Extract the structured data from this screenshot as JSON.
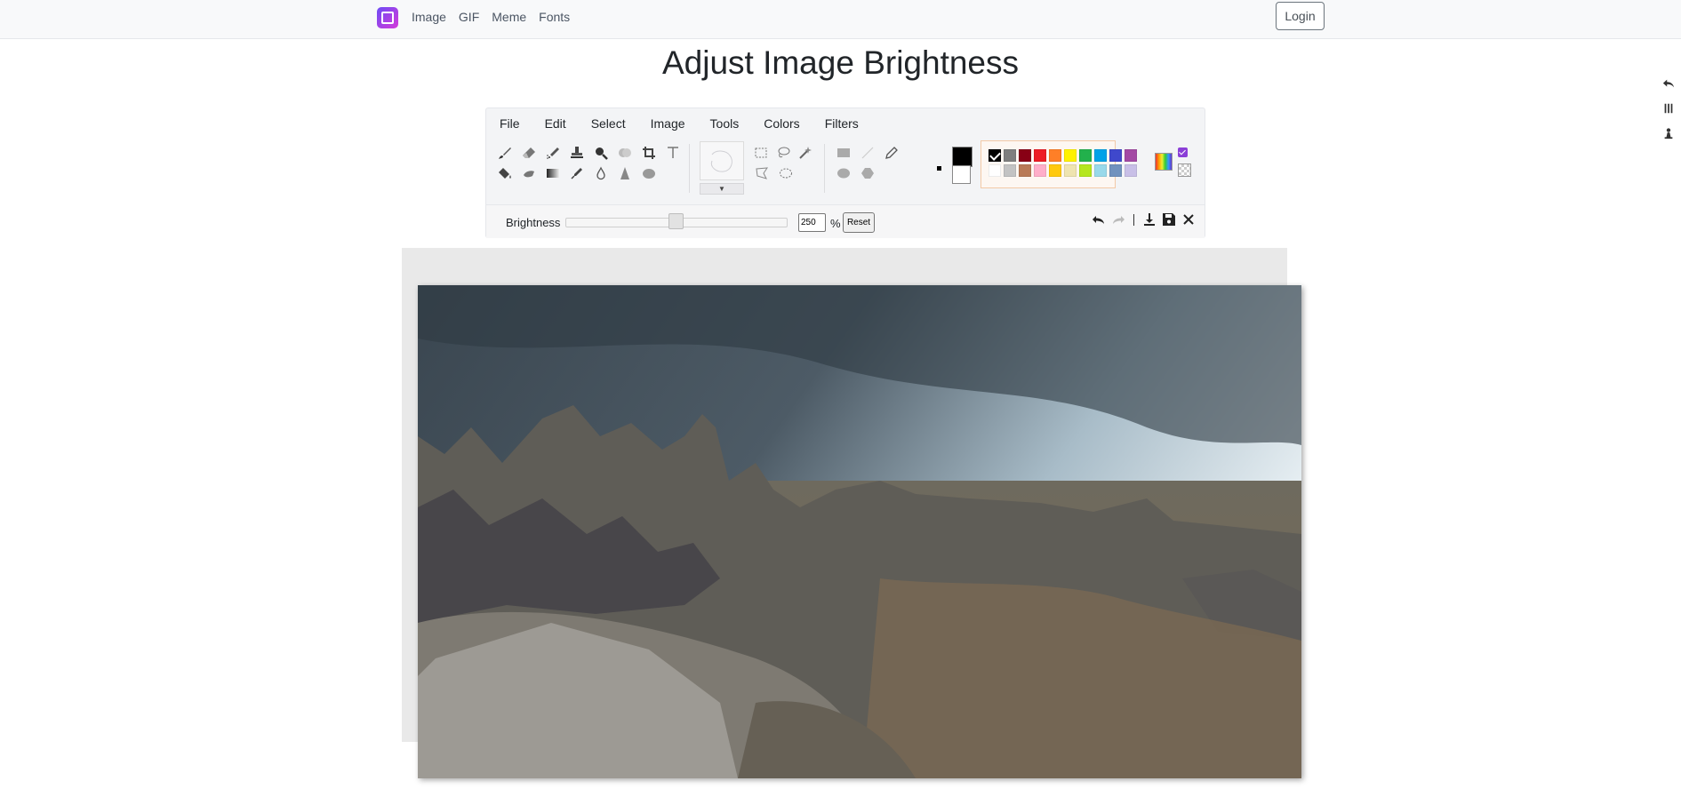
{
  "nav": {
    "links": [
      "Image",
      "GIF",
      "Meme",
      "Fonts"
    ],
    "login_label": "Login"
  },
  "page_title": "Adjust Image Brightness",
  "editor": {
    "menu": [
      "File",
      "Edit",
      "Select",
      "Image",
      "Tools",
      "Colors",
      "Filters"
    ],
    "tools_row1": [
      "brush-icon",
      "eraser-icon",
      "airbrush-icon",
      "stamp-icon",
      "zoom-icon",
      "clone-icon",
      "crop-icon",
      "text-icon"
    ],
    "tools_row2": [
      "fill-bucket-icon",
      "smudge-icon",
      "gradient-icon",
      "color-picker-icon",
      "blur-icon",
      "sharpen-icon",
      "blob-icon"
    ],
    "selection_row1": [
      "rect-select-icon",
      "lasso-icon",
      "magic-wand-icon"
    ],
    "selection_row2": [
      "polygon-lasso-icon",
      "ellipse-select-icon"
    ],
    "shape_row1": [
      "rectangle-icon",
      "line-icon",
      "pencil-icon"
    ],
    "shape_row2": [
      "ellipse-icon",
      "polygon-icon"
    ],
    "foreground_color": "#000000",
    "background_color": "#ffffff",
    "palette_row1": [
      "#000000",
      "#7f7f7f",
      "#880015",
      "#ed1c24",
      "#ff7f27",
      "#fff200",
      "#22b14c",
      "#00a2e8",
      "#3f48cc",
      "#a349a4"
    ],
    "palette_row2": [
      "#ffffff",
      "#c3c3c3",
      "#b97a57",
      "#ffaec9",
      "#ffc90e",
      "#efe4b0",
      "#b5e61d",
      "#99d9ea",
      "#7092be",
      "#c8bfe7"
    ],
    "brightness": {
      "label": "Brightness",
      "value": "250",
      "unit": "%",
      "slider_fraction": 0.5,
      "reset_label": "Reset"
    }
  }
}
